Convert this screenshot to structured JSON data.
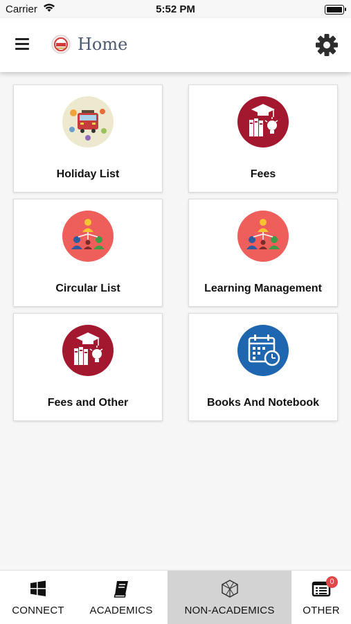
{
  "status_bar": {
    "carrier": "Carrier",
    "time": "5:52 PM"
  },
  "app_bar": {
    "title": "Home"
  },
  "modules": [
    {
      "label": "Holiday List",
      "icon": "holiday-bus-icon"
    },
    {
      "label": "Fees",
      "icon": "graduation-books-icon"
    },
    {
      "label": "Circular List",
      "icon": "people-network-icon"
    },
    {
      "label": "Learning Management",
      "icon": "people-network-icon"
    },
    {
      "label": "Fees and Other",
      "icon": "graduation-books-icon"
    },
    {
      "label": "Books And Notebook",
      "icon": "calendar-clock-icon"
    }
  ],
  "tab_bar": {
    "tabs": [
      {
        "label": "CONNECT",
        "icon": "windows-grid-icon"
      },
      {
        "label": "ACADEMICS",
        "icon": "book-icon"
      },
      {
        "label": "NON-ACADEMICS",
        "icon": "cube-icon",
        "active": true
      },
      {
        "label": "OTHER",
        "icon": "list-icon",
        "badge": "0"
      }
    ]
  },
  "colors": {
    "maroon": "#a3182f",
    "coral": "#ee5f5b",
    "blue": "#1e66b0",
    "active_tab": "#d3d3d3",
    "badge": "#e04848"
  }
}
